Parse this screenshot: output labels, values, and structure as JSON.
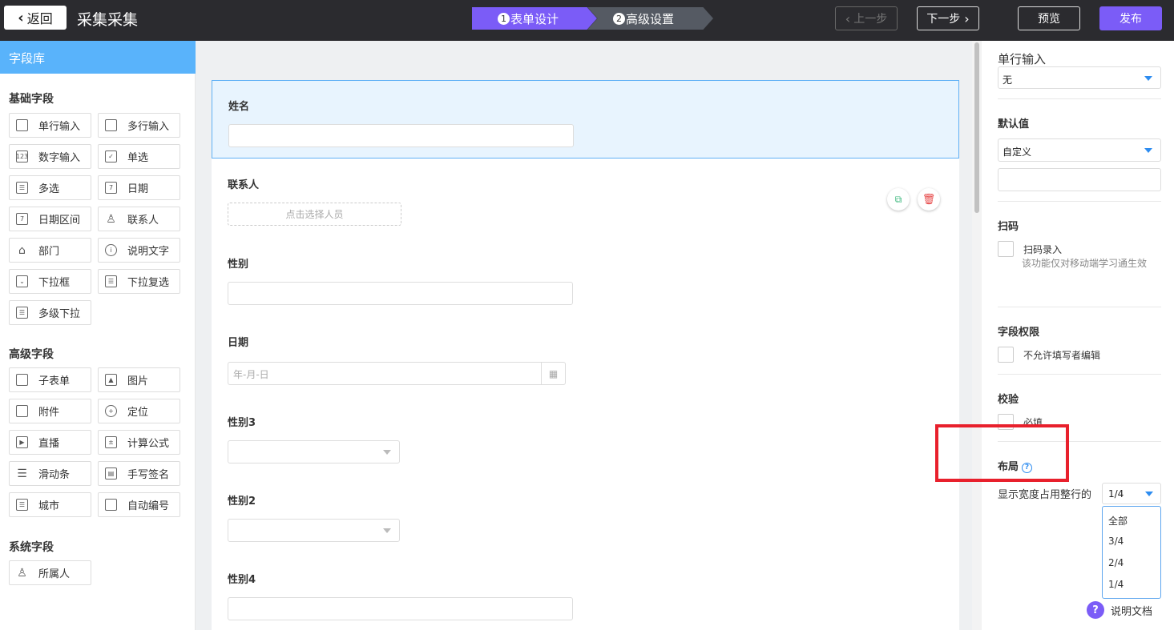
{
  "topbar": {
    "back_label": "返回",
    "title": "采集采集",
    "steps": [
      {
        "num": "1",
        "label": "表单设计"
      },
      {
        "num": "2",
        "label": "高级设置"
      }
    ],
    "prev_label": "上一步",
    "next_label": "下一步",
    "preview_label": "预览",
    "publish_label": "发布"
  },
  "sidebar": {
    "header": "字段库",
    "basic_title": "基础字段",
    "basic_fields": [
      "单行输入",
      "多行输入",
      "数字输入",
      "单选",
      "多选",
      "日期",
      "日期区间",
      "联系人",
      "部门",
      "说明文字",
      "下拉框",
      "下拉复选",
      "多级下拉"
    ],
    "advanced_title": "高级字段",
    "advanced_fields": [
      "子表单",
      "图片",
      "附件",
      "定位",
      "直播",
      "计算公式",
      "滑动条",
      "手写签名",
      "城市",
      "自动编号"
    ],
    "system_title": "系统字段",
    "system_fields": [
      "所属人"
    ]
  },
  "form": {
    "fields": [
      {
        "label": "姓名",
        "type": "text"
      },
      {
        "label": "联系人",
        "type": "people",
        "placeholder": "点击选择人员"
      },
      {
        "label": "性别",
        "type": "text"
      },
      {
        "label": "日期",
        "type": "date",
        "placeholder": "年-月-日"
      },
      {
        "label": "性别3",
        "type": "select"
      },
      {
        "label": "性别2",
        "type": "select"
      },
      {
        "label": "性别4",
        "type": "text"
      }
    ]
  },
  "panel": {
    "title": "单行输入",
    "top_select_value": "无",
    "default_label": "默认值",
    "default_select_value": "自定义",
    "scan_label": "扫码",
    "scan_option": "扫码录入",
    "scan_hint": "该功能仅对移动端学习通生效",
    "permission_label": "字段权限",
    "permission_option": "不允许填写者编辑",
    "validate_label": "校验",
    "validate_option": "必填",
    "layout_label": "布局",
    "width_label": "显示宽度占用整行的",
    "width_value": "1/4",
    "width_options": [
      "全部",
      "3/4",
      "2/4",
      "1/4"
    ],
    "docs_label": "说明文档"
  },
  "colors": {
    "accent": "#7b5cf7",
    "sidebar_header": "#59b3fb",
    "selected_bg": "#e8f4fe",
    "highlight": "#e8202c"
  }
}
